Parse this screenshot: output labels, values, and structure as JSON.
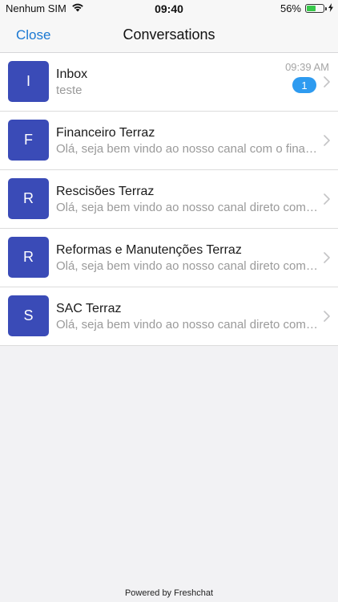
{
  "status_bar": {
    "carrier": "Nenhum SIM",
    "time": "09:40",
    "battery_percent": "56%",
    "battery_level": 0.56,
    "icons": [
      "wifi-icon",
      "battery-icon",
      "charging-icon"
    ],
    "battery_color": "#37c84a"
  },
  "nav": {
    "close_label": "Close",
    "title": "Conversations",
    "accent_color": "#1a78d2"
  },
  "conversations": [
    {
      "initial": "I",
      "title": "Inbox",
      "preview": "teste",
      "time": "09:39 AM",
      "unread": "1"
    },
    {
      "initial": "F",
      "title": "Financeiro Terraz",
      "preview": "Olá, seja bem vindo ao nosso canal com o financeiro"
    },
    {
      "initial": "R",
      "title": "Rescisões Terraz",
      "preview": "Olá, seja bem vindo ao nosso canal direto com o setor"
    },
    {
      "initial": "R",
      "title": "Reformas e Manutenções Terraz",
      "preview": "Olá, seja bem vindo ao nosso canal direto com o setor"
    },
    {
      "initial": "S",
      "title": "SAC Terraz",
      "preview": "Olá, seja bem vindo ao nosso canal direto com o setor"
    }
  ],
  "colors": {
    "avatar": "#3a4bb7",
    "badge": "#2e9bf0"
  },
  "footer": {
    "text": "Powered by Freshchat"
  }
}
